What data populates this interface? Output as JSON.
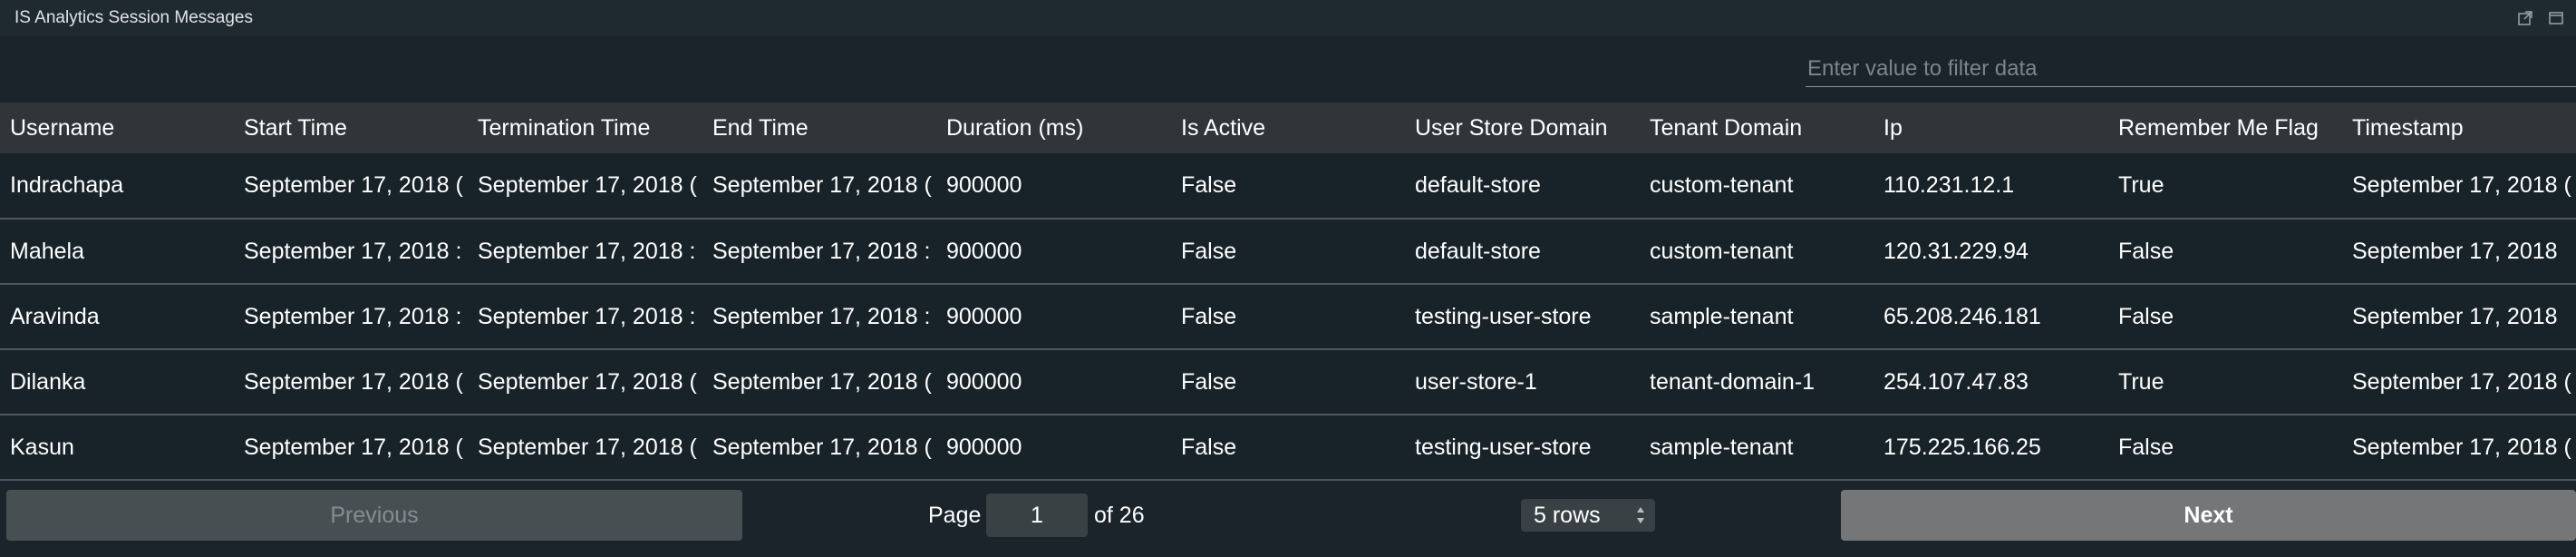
{
  "widget": {
    "title": "IS Analytics Session Messages"
  },
  "filter": {
    "placeholder": "Enter value to filter data"
  },
  "table": {
    "columns": [
      "Username",
      "Start Time",
      "Termination Time",
      "End Time",
      "Duration (ms)",
      "Is Active",
      "User Store Domain",
      "Tenant Domain",
      "Ip",
      "Remember Me Flag",
      "Timestamp"
    ],
    "rows": [
      [
        "Indrachapa",
        "September 17, 2018 (",
        "September 17, 2018 (",
        "September 17, 2018 (",
        "900000",
        "False",
        "default-store",
        "custom-tenant",
        "110.231.12.1",
        "True",
        "September 17, 2018 ("
      ],
      [
        "Mahela",
        "September 17, 2018 :",
        "September 17, 2018 :",
        "September 17, 2018 :",
        "900000",
        "False",
        "default-store",
        "custom-tenant",
        "120.31.229.94",
        "False",
        "September 17, 2018"
      ],
      [
        "Aravinda",
        "September 17, 2018 :",
        "September 17, 2018 :",
        "September 17, 2018 :",
        "900000",
        "False",
        "testing-user-store",
        "sample-tenant",
        "65.208.246.181",
        "False",
        "September 17, 2018"
      ],
      [
        "Dilanka",
        "September 17, 2018 (",
        "September 17, 2018 (",
        "September 17, 2018 (",
        "900000",
        "False",
        "user-store-1",
        "tenant-domain-1",
        "254.107.47.83",
        "True",
        "September 17, 2018 ("
      ],
      [
        "Kasun",
        "September 17, 2018 (",
        "September 17, 2018 (",
        "September 17, 2018 (",
        "900000",
        "False",
        "testing-user-store",
        "sample-tenant",
        "175.225.166.25",
        "False",
        "September 17, 2018 ("
      ]
    ]
  },
  "pagination": {
    "previous_label": "Previous",
    "next_label": "Next",
    "page_label": "Page",
    "current_page": "1",
    "of_label": "of 26",
    "rows_selected": "5 rows"
  },
  "colors": {
    "background": "#1a242a",
    "header_bg": "#303539",
    "row_border": "#4d565c"
  },
  "icons": [
    "popout-icon",
    "maximize-icon",
    "sort-arrows-icon"
  ]
}
